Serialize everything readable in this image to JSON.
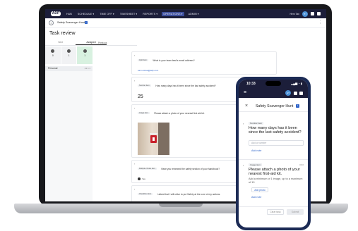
{
  "laptop": {
    "nav": {
      "logo": "ADP",
      "items": [
        "HUB",
        "SCHEDULE ▾",
        "TIME OFF ▾",
        "TIMESHEET ▾",
        "REPORTS ▾",
        "OPERATIONS ▾",
        "ADMIN ▾"
      ],
      "active_index": 5,
      "user": "Hem Tan",
      "avatar": "HT"
    },
    "task": {
      "title": "Safety Scavenger Hunt",
      "info_icon": "i"
    },
    "heading": "Task review",
    "left": {
      "tabs": [
        "Sent",
        "Assigned"
      ],
      "selected_tab": 1,
      "previous_tab": "Previous",
      "status": [
        {
          "count": "0"
        },
        {
          "count": "1"
        },
        {
          "count": "1"
        }
      ],
      "personal": "Personal",
      "personal_meta": "1/2  1:1"
    },
    "feed": [
      {
        "chip": "Quiz item",
        "question": "What is your team lead's email address?",
        "answer_link": "sam.oshea@adp.com"
      },
      {
        "chip": "Number item",
        "question": "How many days has it been since the last safety accident?",
        "answer_big": "25"
      },
      {
        "chip": "Image item",
        "question": "Please attach a photo of your nearest first aid kit."
      },
      {
        "chip": "Multiple choice item",
        "question": "Have you reviewed the safety section of your handbook?",
        "radio": "Yes"
      },
      {
        "chip": "Checkbox item",
        "question": "I attest that I will strive to put Safety at the core of my actions."
      }
    ]
  },
  "phone": {
    "time": "10:33",
    "signal": "▂▄▆ ◔ ▮",
    "avatar": "HT",
    "title": "Safety Scavenger Hunt",
    "info_icon": "i",
    "card1": {
      "chip": "Number item",
      "question": "How many days has it been since the last safety accident?",
      "placeholder": "Add a number",
      "link": "Add note"
    },
    "card2": {
      "chip": "Image item",
      "meta": "0/10",
      "question": "Please attach a photo of your nearest first-aid kit.",
      "sub": "Add a minimum of 1 image, up to a maximum of 10",
      "button": "Add photo",
      "link": "Add note"
    },
    "footer": {
      "secondary": "Clear task",
      "primary": "Submit"
    }
  }
}
